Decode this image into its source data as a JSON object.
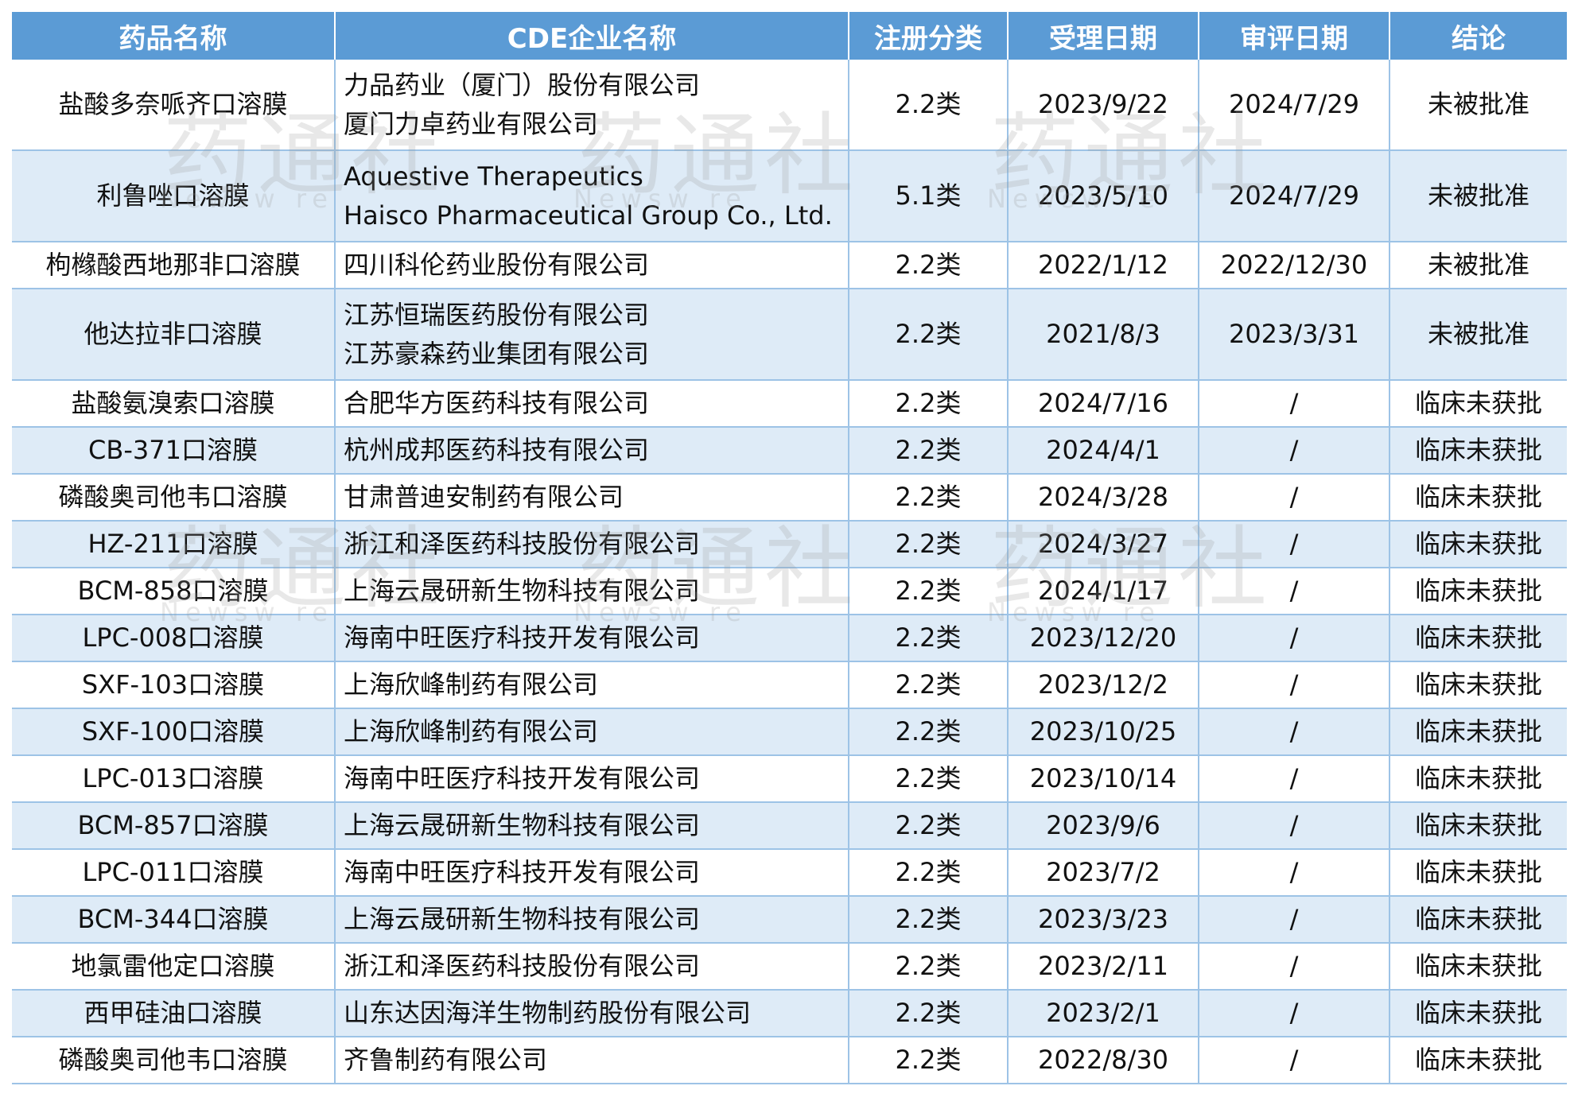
{
  "headers": [
    "药品名称",
    "CDE企业名称",
    "注册分类",
    "受理日期",
    "审评日期",
    "结论"
  ],
  "rows": [
    {
      "drug": "盐酸多奈哌齐口溶膜",
      "company": [
        "力品药业（厦门）股份有限公司",
        "厦门力卓药业有限公司"
      ],
      "category": "2.2类",
      "accepted": "2023/9/22",
      "reviewed": "2024/7/29",
      "conclusion": "未被批准"
    },
    {
      "drug": "利鲁唑口溶膜",
      "company": [
        "Aquestive Therapeutics",
        "Haisco Pharmaceutical Group Co., Ltd."
      ],
      "category": "5.1类",
      "accepted": "2023/5/10",
      "reviewed": "2024/7/29",
      "conclusion": "未被批准"
    },
    {
      "drug": "枸橼酸西地那非口溶膜",
      "company": [
        "四川科伦药业股份有限公司"
      ],
      "category": "2.2类",
      "accepted": "2022/1/12",
      "reviewed": "2022/12/30",
      "conclusion": "未被批准"
    },
    {
      "drug": "他达拉非口溶膜",
      "company": [
        "江苏恒瑞医药股份有限公司",
        "江苏豪森药业集团有限公司"
      ],
      "category": "2.2类",
      "accepted": "2021/8/3",
      "reviewed": "2023/3/31",
      "conclusion": "未被批准"
    },
    {
      "drug": "盐酸氨溴索口溶膜",
      "company": [
        "合肥华方医药科技有限公司"
      ],
      "category": "2.2类",
      "accepted": "2024/7/16",
      "reviewed": "/",
      "conclusion": "临床未获批"
    },
    {
      "drug": "CB-371口溶膜",
      "company": [
        "杭州成邦医药科技有限公司"
      ],
      "category": "2.2类",
      "accepted": "2024/4/1",
      "reviewed": "/",
      "conclusion": "临床未获批"
    },
    {
      "drug": "磷酸奥司他韦口溶膜",
      "company": [
        "甘肃普迪安制药有限公司"
      ],
      "category": "2.2类",
      "accepted": "2024/3/28",
      "reviewed": "/",
      "conclusion": "临床未获批"
    },
    {
      "drug": "HZ-211口溶膜",
      "company": [
        "浙江和泽医药科技股份有限公司"
      ],
      "category": "2.2类",
      "accepted": "2024/3/27",
      "reviewed": "/",
      "conclusion": "临床未获批"
    },
    {
      "drug": "BCM-858口溶膜",
      "company": [
        "上海云晟研新生物科技有限公司"
      ],
      "category": "2.2类",
      "accepted": "2024/1/17",
      "reviewed": "/",
      "conclusion": "临床未获批"
    },
    {
      "drug": "LPC-008口溶膜",
      "company": [
        "海南中旺医疗科技开发有限公司"
      ],
      "category": "2.2类",
      "accepted": "2023/12/20",
      "reviewed": "/",
      "conclusion": "临床未获批"
    },
    {
      "drug": "SXF-103口溶膜",
      "company": [
        "上海欣峰制药有限公司"
      ],
      "category": "2.2类",
      "accepted": "2023/12/2",
      "reviewed": "/",
      "conclusion": "临床未获批"
    },
    {
      "drug": "SXF-100口溶膜",
      "company": [
        "上海欣峰制药有限公司"
      ],
      "category": "2.2类",
      "accepted": "2023/10/25",
      "reviewed": "/",
      "conclusion": "临床未获批"
    },
    {
      "drug": "LPC-013口溶膜",
      "company": [
        "海南中旺医疗科技开发有限公司"
      ],
      "category": "2.2类",
      "accepted": "2023/10/14",
      "reviewed": "/",
      "conclusion": "临床未获批"
    },
    {
      "drug": "BCM-857口溶膜",
      "company": [
        "上海云晟研新生物科技有限公司"
      ],
      "category": "2.2类",
      "accepted": "2023/9/6",
      "reviewed": "/",
      "conclusion": "临床未获批"
    },
    {
      "drug": "LPC-011口溶膜",
      "company": [
        "海南中旺医疗科技开发有限公司"
      ],
      "category": "2.2类",
      "accepted": "2023/7/2",
      "reviewed": "/",
      "conclusion": "临床未获批"
    },
    {
      "drug": "BCM-344口溶膜",
      "company": [
        "上海云晟研新生物科技有限公司"
      ],
      "category": "2.2类",
      "accepted": "2023/3/23",
      "reviewed": "/",
      "conclusion": "临床未获批"
    },
    {
      "drug": "地氯雷他定口溶膜",
      "company": [
        "浙江和泽医药科技股份有限公司"
      ],
      "category": "2.2类",
      "accepted": "2023/2/11",
      "reviewed": "/",
      "conclusion": "临床未获批"
    },
    {
      "drug": "西甲硅油口溶膜",
      "company": [
        "山东达因海洋生物制药股份有限公司"
      ],
      "category": "2.2类",
      "accepted": "2023/2/1",
      "reviewed": "/",
      "conclusion": "临床未获批"
    },
    {
      "drug": "磷酸奥司他韦口溶膜",
      "company": [
        "齐鲁制药有限公司"
      ],
      "category": "2.2类",
      "accepted": "2022/8/30",
      "reviewed": "/",
      "conclusion": "临床未获批"
    }
  ],
  "watermark": {
    "mark": "药通社",
    "sub": "Newsw re"
  },
  "colors": {
    "header_bg": "#5b9bd5",
    "stripe_bg": "#deebf7",
    "grid": "#9dc3e6"
  }
}
